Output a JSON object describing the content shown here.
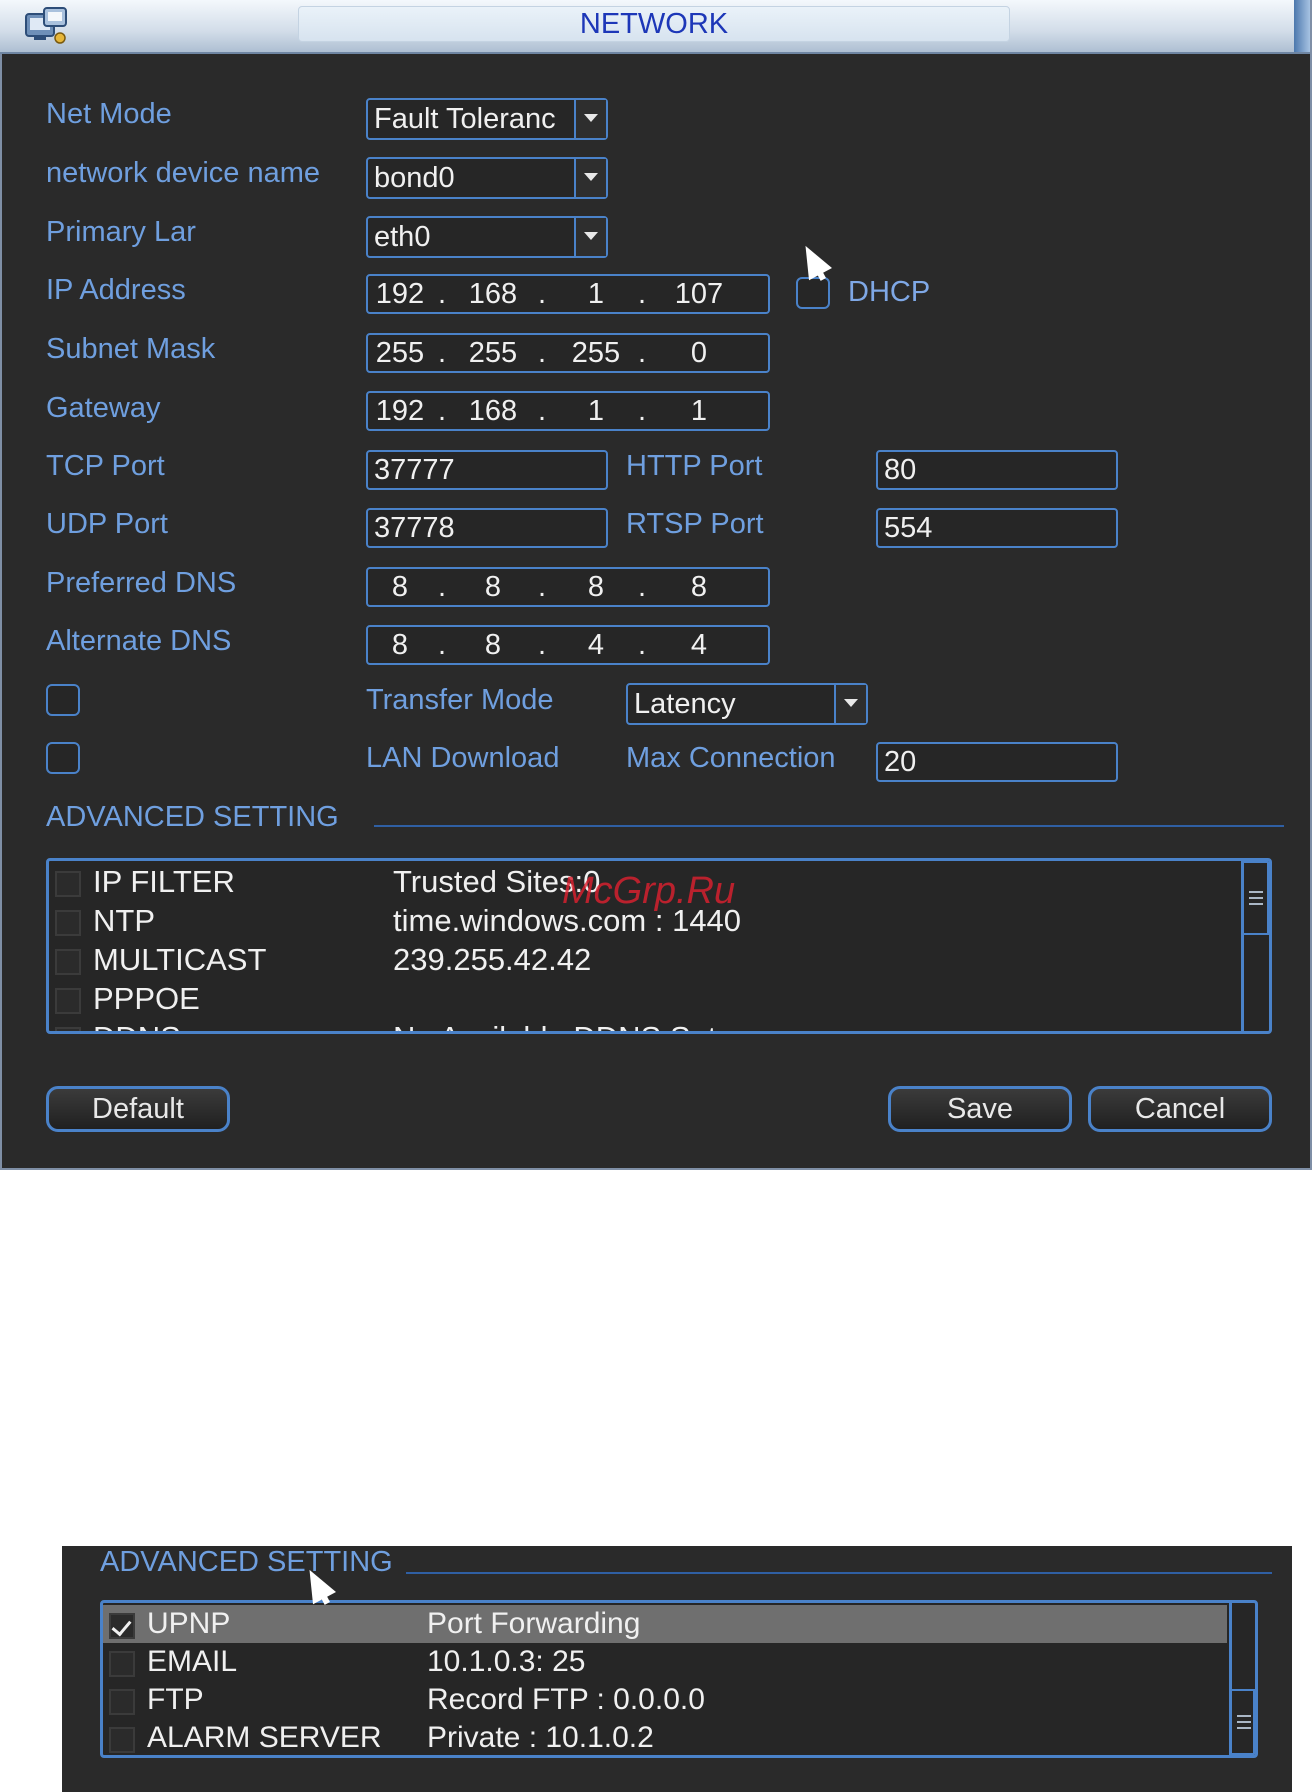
{
  "window": {
    "title": "NETWORK"
  },
  "form": {
    "net_mode": {
      "label": "Net Mode",
      "value": "Fault Toleranc"
    },
    "device_name": {
      "label": "network device name",
      "value": "bond0"
    },
    "primary_lan": {
      "label": "Primary Lar",
      "value": "eth0"
    },
    "ip_address": {
      "label": "IP Address",
      "octets": [
        "192",
        "168",
        "1",
        "107"
      ]
    },
    "dhcp": {
      "label": "DHCP",
      "checked": false
    },
    "subnet_mask": {
      "label": "Subnet Mask",
      "octets": [
        "255",
        "255",
        "255",
        "0"
      ]
    },
    "gateway": {
      "label": "Gateway",
      "octets": [
        "192",
        "168",
        "1",
        "1"
      ]
    },
    "tcp_port": {
      "label": "TCP Port",
      "value": "37777"
    },
    "http_port": {
      "label": "HTTP Port",
      "value": "80"
    },
    "udp_port": {
      "label": "UDP Port",
      "value": "37778"
    },
    "rtsp_port": {
      "label": "RTSP Port",
      "value": "554"
    },
    "preferred_dns": {
      "label": "Preferred DNS",
      "octets": [
        "8",
        "8",
        "8",
        "8"
      ]
    },
    "alternate_dns": {
      "label": "Alternate DNS",
      "octets": [
        "8",
        "8",
        "4",
        "4"
      ]
    },
    "transfer_mode": {
      "label": "Transfer Mode",
      "value": "Latency",
      "checked": false
    },
    "lan_download": {
      "label": "LAN Download",
      "checked": false
    },
    "max_connection": {
      "label": "Max Connection",
      "value": "20"
    }
  },
  "advanced": {
    "heading": "ADVANCED SETTING",
    "rows": [
      {
        "name": "IP FILTER",
        "value": "Trusted Sites:0"
      },
      {
        "name": "NTP",
        "value": "time.windows.com : 1440"
      },
      {
        "name": "MULTICAST",
        "value": "239.255.42.42"
      },
      {
        "name": "PPPOE",
        "value": ""
      },
      {
        "name": "DDNS",
        "value": "No Available DDNS Setup"
      }
    ]
  },
  "buttons": {
    "default": "Default",
    "save": "Save",
    "cancel": "Cancel"
  },
  "watermark": "McGrp.Ru",
  "advanced2": {
    "heading": "ADVANCED SETTING",
    "rows": [
      {
        "name": "UPNP",
        "value": "Port Forwarding",
        "checked": true,
        "selected": true
      },
      {
        "name": "EMAIL",
        "value": "10.1.0.3: 25",
        "checked": false
      },
      {
        "name": "FTP",
        "value": "Record FTP : 0.0.0.0",
        "checked": false
      },
      {
        "name": "ALARM SERVER",
        "value": "Private : 10.1.0.2",
        "checked": false
      }
    ]
  },
  "colors": {
    "label": "#6f9fdf",
    "border": "#4a82c9",
    "title": "#1d37b8",
    "background": "#2a2a2a"
  }
}
